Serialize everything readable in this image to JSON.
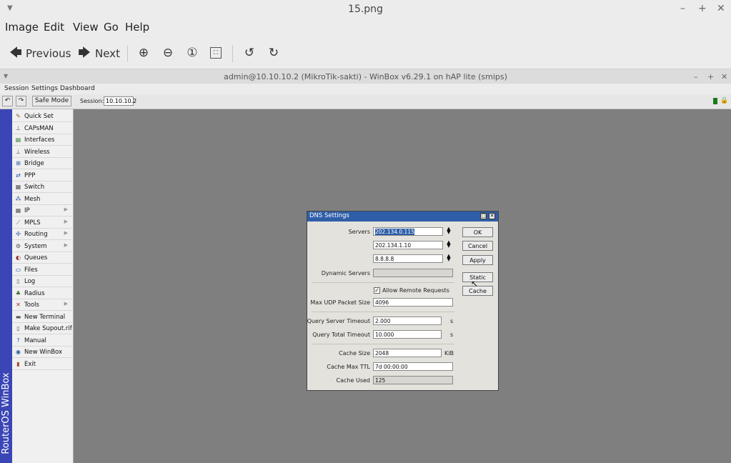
{
  "viewer": {
    "title": "15.png",
    "menu": [
      "Image",
      "Edit",
      "View",
      "Go",
      "Help"
    ],
    "toolbar": {
      "previous": "Previous",
      "next": "Next"
    }
  },
  "winbox": {
    "title": "admin@10.10.10.2 (MikroTik-sakti) - WinBox v6.29.1 on hAP lite (smips)",
    "menu": [
      "Session",
      "Settings",
      "Dashboard"
    ],
    "safe_mode": "Safe Mode",
    "session_label": "Session:",
    "session_value": "10.10.10.2",
    "brand": "RouterOS WinBox",
    "sidebar": [
      {
        "label": "Quick Set",
        "icon": "quick-set-icon",
        "arrow": false
      },
      {
        "label": "CAPsMAN",
        "icon": "capsman-icon",
        "arrow": false
      },
      {
        "label": "Interfaces",
        "icon": "interfaces-icon",
        "arrow": false
      },
      {
        "label": "Wireless",
        "icon": "wireless-icon",
        "arrow": false
      },
      {
        "label": "Bridge",
        "icon": "bridge-icon",
        "arrow": false
      },
      {
        "label": "PPP",
        "icon": "ppp-icon",
        "arrow": false
      },
      {
        "label": "Switch",
        "icon": "switch-icon",
        "arrow": false
      },
      {
        "label": "Mesh",
        "icon": "mesh-icon",
        "arrow": false
      },
      {
        "label": "IP",
        "icon": "ip-icon",
        "arrow": true
      },
      {
        "label": "MPLS",
        "icon": "mpls-icon",
        "arrow": true
      },
      {
        "label": "Routing",
        "icon": "routing-icon",
        "arrow": true
      },
      {
        "label": "System",
        "icon": "system-icon",
        "arrow": true
      },
      {
        "label": "Queues",
        "icon": "queues-icon",
        "arrow": false
      },
      {
        "label": "Files",
        "icon": "files-icon",
        "arrow": false
      },
      {
        "label": "Log",
        "icon": "log-icon",
        "arrow": false
      },
      {
        "label": "Radius",
        "icon": "radius-icon",
        "arrow": false
      },
      {
        "label": "Tools",
        "icon": "tools-icon",
        "arrow": true
      },
      {
        "label": "New Terminal",
        "icon": "terminal-icon",
        "arrow": false
      },
      {
        "label": "Make Supout.rif",
        "icon": "supout-icon",
        "arrow": false
      },
      {
        "label": "Manual",
        "icon": "manual-icon",
        "arrow": false
      },
      {
        "label": "New WinBox",
        "icon": "winbox-icon",
        "arrow": false
      },
      {
        "label": "Exit",
        "icon": "exit-icon",
        "arrow": false
      }
    ]
  },
  "dns": {
    "title": "DNS Settings",
    "servers_label": "Servers",
    "servers": [
      "202.134.0.115",
      "202.134.1.10",
      "8.8.8.8"
    ],
    "dynamic_servers_label": "Dynamic Servers",
    "dynamic_servers_value": "",
    "allow_remote_label": "Allow Remote Requests",
    "allow_remote_checked": true,
    "max_udp_label": "Max UDP Packet Size",
    "max_udp_value": "4096",
    "query_server_label": "Query Server Timeout",
    "query_server_value": "2.000",
    "query_server_unit": "s",
    "query_total_label": "Query Total Timeout",
    "query_total_value": "10.000",
    "query_total_unit": "s",
    "cache_size_label": "Cache Size",
    "cache_size_value": "2048",
    "cache_size_unit": "KiB",
    "cache_ttl_label": "Cache Max TTL",
    "cache_ttl_value": "7d 00:00:00",
    "cache_used_label": "Cache Used",
    "cache_used_value": "125",
    "buttons": {
      "ok": "OK",
      "cancel": "Cancel",
      "apply": "Apply",
      "static": "Static",
      "cache": "Cache"
    }
  }
}
